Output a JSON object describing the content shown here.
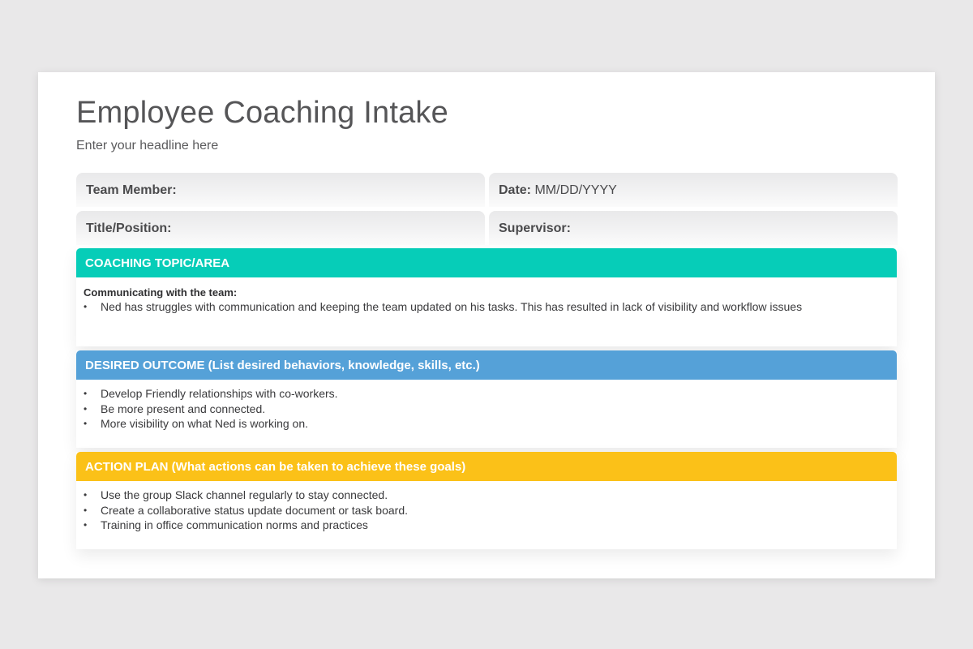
{
  "slide": {
    "title": "Employee Coaching Intake",
    "subtitle": "Enter your headline here"
  },
  "fields": {
    "team_member_label": "Team Member:",
    "date_label": "Date:",
    "date_value": "MM/DD/YYYY",
    "title_position_label": "Title/Position:",
    "supervisor_label": "Supervisor:"
  },
  "sections": {
    "topic": {
      "header": "COACHING TOPIC/AREA",
      "color": "#06cdb8",
      "heading": "Communicating with the team:",
      "items": [
        "Ned has struggles with communication and keeping the team updated on his tasks. This has resulted in lack of visibility and workflow issues"
      ]
    },
    "outcome": {
      "header": "DESIRED OUTCOME (List desired behaviors, knowledge, skills, etc.)",
      "color": "#55a1d8",
      "items": [
        "Develop Friendly relationships with co-workers.",
        "Be more present and connected.",
        "More visibility on what Ned is working on."
      ]
    },
    "action": {
      "header": "ACTION PLAN (What actions can be taken to achieve these goals)",
      "color": "#fbc118",
      "items": [
        "Use the group Slack channel regularly to stay connected.",
        "Create a collaborative status update document or task board.",
        "Training in office communication norms and practices"
      ]
    }
  }
}
